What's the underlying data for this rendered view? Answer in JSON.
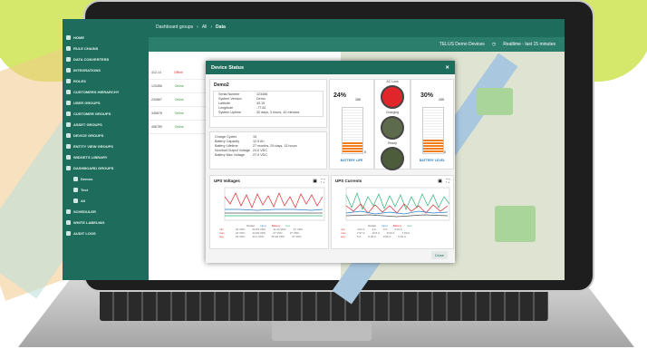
{
  "topbar": {
    "dashboard_groups": "Dashboard groups",
    "all": "All",
    "data": "Data",
    "devices": "TELUS Demo Devices",
    "realtime": "Realtime - last 15 minutes"
  },
  "sidebar": {
    "items": [
      {
        "label": "HOME"
      },
      {
        "label": "RULE CHAINS"
      },
      {
        "label": "DATA CONVERTERS"
      },
      {
        "label": "INTEGRATIONS"
      },
      {
        "label": "ROLES"
      },
      {
        "label": "CUSTOMERS HIERARCHY"
      },
      {
        "label": "USER GROUPS"
      },
      {
        "label": "CUSTOMER GROUPS"
      },
      {
        "label": "ASSET GROUPS"
      },
      {
        "label": "DEVICE GROUPS"
      },
      {
        "label": "ENTITY VIEW GROUPS"
      },
      {
        "label": "WIDGETS LIBRARY"
      },
      {
        "label": "DASHBOARD GROUPS"
      },
      {
        "label": "Demos"
      },
      {
        "label": "Test"
      },
      {
        "label": "All"
      },
      {
        "label": "SCHEDULER"
      },
      {
        "label": "WHITE LABELING"
      },
      {
        "label": "AUDIT LOGS"
      }
    ]
  },
  "list": {
    "rows": [
      {
        "id": "412-14",
        "status": "Offline"
      },
      {
        "id": "123456",
        "status": "Online"
      },
      {
        "id": "234567",
        "status": "Online"
      },
      {
        "id": "345678",
        "status": "Online"
      },
      {
        "id": "456789",
        "status": "Online"
      }
    ]
  },
  "dialog": {
    "title": "Device Status",
    "device_name": "Demo2",
    "info": [
      {
        "k": "Serial Number",
        "v": "123456"
      },
      {
        "k": "System Version",
        "v": "Demo"
      },
      {
        "k": "Latitude",
        "v": "43.15"
      },
      {
        "k": "Longitude",
        "v": "-77.62"
      },
      {
        "k": "System Uptime",
        "v": "32 days, 3 hours, 42 minutes"
      }
    ],
    "battery": [
      {
        "k": "Charge Cycles",
        "v": "15"
      },
      {
        "k": "Battery Capacity",
        "v": "12.0 Ah"
      },
      {
        "k": "Battery Lifetime",
        "v": "27 months, 29 days, 13 hours"
      },
      {
        "k": "Nominal Output Voltage",
        "v": "24.0 VDC"
      },
      {
        "k": "Battery Max Voltage",
        "v": "27.0 VDC"
      }
    ],
    "battery_life": {
      "pct_label": "24%",
      "max": "100",
      "min": "0",
      "label": "BATTERY LIFE",
      "level": 0.24
    },
    "battery_level": {
      "pct_label": "30%",
      "max": "100",
      "min": "0",
      "label": "BATTERY LEVEL",
      "level": 0.3
    },
    "lamps": [
      {
        "label": "AC Loss",
        "color": "#e0262b"
      },
      {
        "label": "Charging",
        "color": "#5d6a4c"
      },
      {
        "label": "Ready",
        "color": "#4d5c3a"
      }
    ],
    "voltages": {
      "title": "UPS Voltages",
      "legend": [
        "Output",
        "Input",
        "Battery",
        "Aux"
      ],
      "stats": [
        {
          "label": "min",
          "values": [
            "24 VDC",
            "22.53 VDC",
            "11.44 VDC",
            "27 VDC"
          ]
        },
        {
          "label": "max",
          "values": [
            "24 VDC",
            "24.99 VDC",
            "27 VDC",
            "27 VDC"
          ]
        },
        {
          "label": "avg",
          "values": [
            "24 VDC",
            "24.1 VDC",
            "20.94 VDC",
            "27 VDC"
          ]
        }
      ]
    },
    "currents": {
      "title": "UPS Currents",
      "legend": [
        "Output",
        "Input",
        "Battery",
        "Aux"
      ],
      "stats": [
        {
          "label": "min",
          "values": [
            "4.01 A",
            "3 A",
            "3 A",
            "3.01 A"
          ]
        },
        {
          "label": "max",
          "values": [
            "7.97 A",
            "10.5 A",
            "8.34 A",
            "7.93 A"
          ]
        },
        {
          "label": "avg",
          "values": [
            "5 A",
            "6.29 A",
            "3.95 A",
            "5.01 A"
          ]
        }
      ]
    },
    "close_label": "Close"
  },
  "colors": {
    "brand": "#1d6c5c",
    "accent_orange": "#f07d1e",
    "accent_blue": "#2a7fc4"
  }
}
